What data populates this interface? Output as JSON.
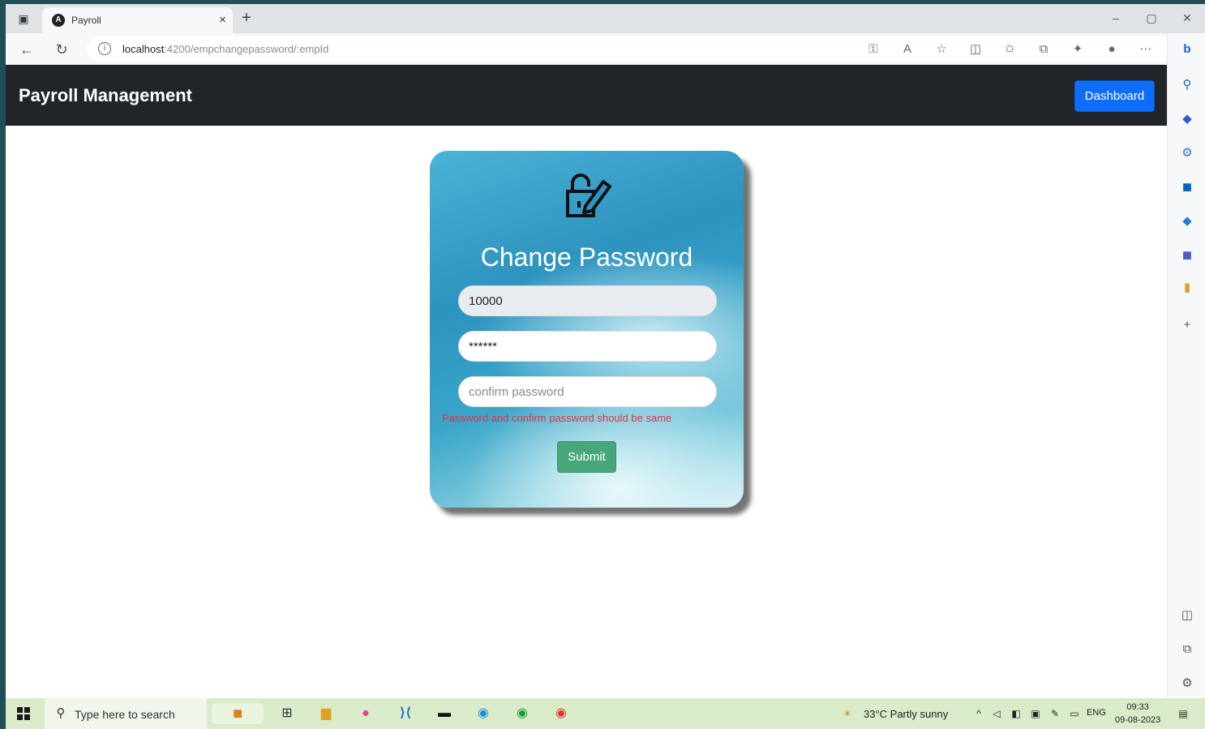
{
  "browser": {
    "tab_title": "Payroll",
    "tab_close": "×",
    "new_tab": "+",
    "url_host": "localhost",
    "url_path": ":4200/empchangepassword/:empId",
    "window_minimize": "–",
    "window_maximize": "▢",
    "window_close": "✕"
  },
  "navbar": {
    "brand": "Payroll Management",
    "dashboard_label": "Dashboard"
  },
  "form": {
    "title": "Change Password",
    "employee_id_value": "10000",
    "password_value": "******",
    "confirm_placeholder": "confirm password",
    "error_message": "Password and confirm password should be same",
    "submit_label": "Submit"
  },
  "taskbar": {
    "search_placeholder": "Type here to search",
    "weather": "33°C  Partly sunny",
    "language": "ENG",
    "time": "09:33",
    "date": "09-08-2023"
  },
  "colors": {
    "navbar": "#212529",
    "dashboard_button": "#0d6efd",
    "submit_button": "#47a77a",
    "error_text": "#dc3545",
    "card_gradient_start": "#4cb2d6"
  }
}
